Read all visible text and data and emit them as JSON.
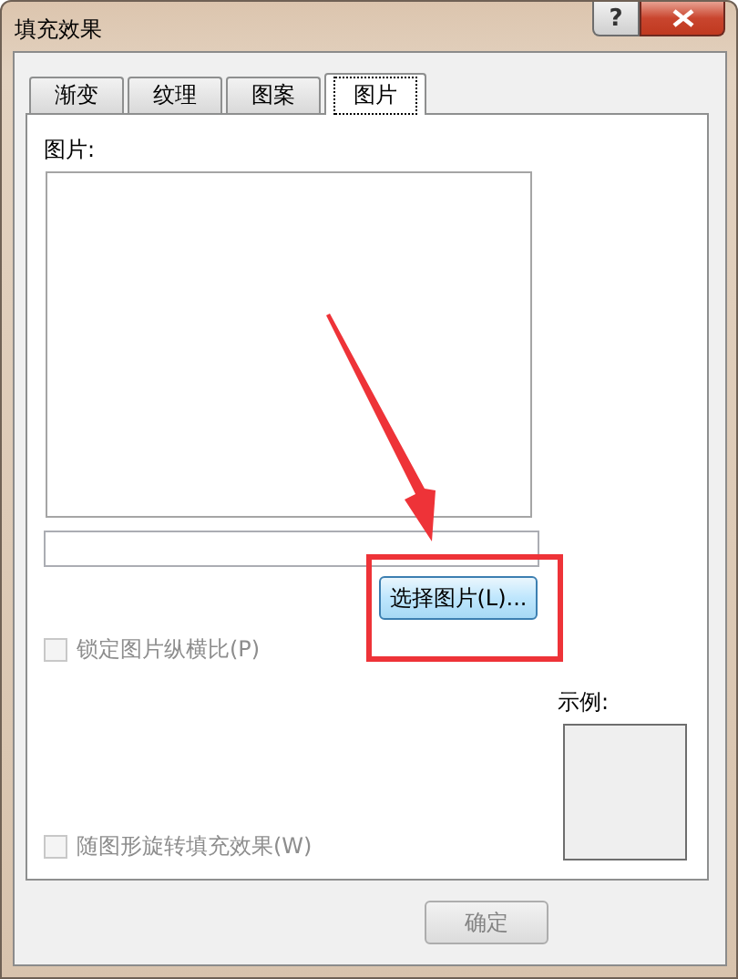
{
  "window": {
    "title": "填充效果",
    "help": "?"
  },
  "tabs": [
    {
      "label": "渐变",
      "selected": false
    },
    {
      "label": "纹理",
      "selected": false
    },
    {
      "label": "图案",
      "selected": false
    },
    {
      "label": "图片",
      "selected": true
    }
  ],
  "picture_label": "图片:",
  "select_button": "选择图片(L)...",
  "checkboxes": [
    {
      "label": "锁定图片纵横比(P)",
      "checked": false,
      "disabled": true
    },
    {
      "label": "随图形旋转填充效果(W)",
      "checked": false,
      "disabled": true
    }
  ],
  "sample_label": "示例:",
  "footer_buttons": [
    {
      "label": "确定",
      "disabled": true
    }
  ]
}
